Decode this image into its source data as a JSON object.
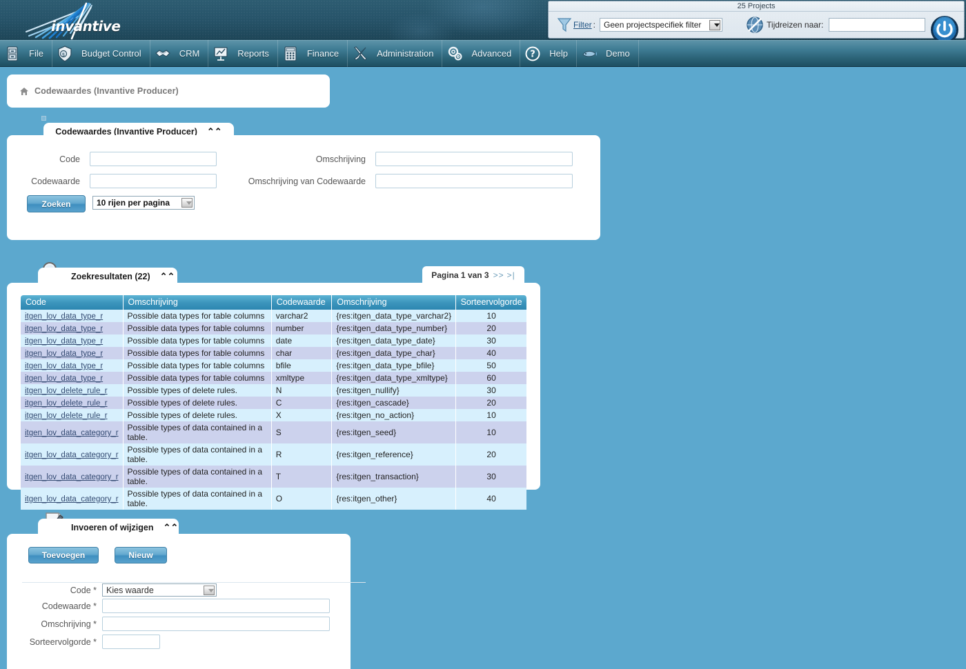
{
  "brand": {
    "name": "invantive"
  },
  "topbar": {
    "projects_title": "25 Projects",
    "filter_label": "Filter",
    "filter_colon": ":",
    "filter_value": "Geen projectspecifiek filter",
    "timetravel_label": "Tijdreizen naar:",
    "timetravel_value": "",
    "power_icon": "power-icon",
    "funnel_icon": "funnel-icon",
    "globe_icon": "globe-no-icon"
  },
  "menu": {
    "items": [
      {
        "label": "File",
        "icon": "cabinet-icon"
      },
      {
        "label": "Budget Control",
        "icon": "shield-coin-icon"
      },
      {
        "label": "CRM",
        "icon": "handshake-icon"
      },
      {
        "label": "Reports",
        "icon": "presentation-chart-icon"
      },
      {
        "label": "Finance",
        "icon": "calculator-icon"
      },
      {
        "label": "Administration",
        "icon": "tools-icon"
      },
      {
        "label": "Advanced",
        "icon": "gears-icon"
      },
      {
        "label": "Help",
        "icon": "question-circle-icon"
      },
      {
        "label": "Demo",
        "icon": "fish-icon"
      }
    ]
  },
  "breadcrumb": {
    "icon": "home-icon",
    "text": "Codewaardes (Invantive Producer)"
  },
  "search_panel": {
    "title": "Codewaardes (Invantive Producer)",
    "collapse_icon": "chevron-up-icon",
    "labels": {
      "code": "Code",
      "codewaarde": "Codewaarde",
      "omschrijving": "Omschrijving",
      "omschrijving_codewaarde": "Omschrijving van Codewaarde"
    },
    "values": {
      "code": "",
      "codewaarde": "",
      "omschrijving": "",
      "omschrijving_codewaarde": ""
    },
    "search_button": "Zoeken",
    "rows_per_page": "10 rijen per pagina"
  },
  "results_panel": {
    "title": "Zoekresultaten (22)",
    "collapse_icon": "chevron-up-icon",
    "search_icon": "magnifier-icon",
    "pager": {
      "text": "Pagina 1 van 3",
      "next": ">>",
      "last": ">|"
    },
    "columns": [
      "Code",
      "Omschrijving",
      "Codewaarde",
      "Omschrijving",
      "Sorteervolgorde"
    ],
    "rows": [
      [
        "itgen_lov_data_type_r",
        "Possible data types for table columns",
        "varchar2",
        "{res:itgen_data_type_varchar2}",
        "10"
      ],
      [
        "itgen_lov_data_type_r",
        "Possible data types for table columns",
        "number",
        "{res:itgen_data_type_number}",
        "20"
      ],
      [
        "itgen_lov_data_type_r",
        "Possible data types for table columns",
        "date",
        "{res:itgen_data_type_date}",
        "30"
      ],
      [
        "itgen_lov_data_type_r",
        "Possible data types for table columns",
        "char",
        "{res:itgen_data_type_char}",
        "40"
      ],
      [
        "itgen_lov_data_type_r",
        "Possible data types for table columns",
        "bfile",
        "{res:itgen_data_type_bfile}",
        "50"
      ],
      [
        "itgen_lov_data_type_r",
        "Possible data types for table columns",
        "xmltype",
        "{res:itgen_data_type_xmltype}",
        "60"
      ],
      [
        "itgen_lov_delete_rule_r",
        "Possible types of delete rules.",
        "N",
        "{res:itgen_nullify}",
        "30"
      ],
      [
        "itgen_lov_delete_rule_r",
        "Possible types of delete rules.",
        "C",
        "{res:itgen_cascade}",
        "20"
      ],
      [
        "itgen_lov_delete_rule_r",
        "Possible types of delete rules.",
        "X",
        "{res:itgen_no_action}",
        "10"
      ],
      [
        "itgen_lov_data_category_r",
        "Possible types of data contained in a table.",
        "S",
        "{res:itgen_seed}",
        "10"
      ],
      [
        "itgen_lov_data_category_r",
        "Possible types of data contained in a table.",
        "R",
        "{res:itgen_reference}",
        "20"
      ],
      [
        "itgen_lov_data_category_r",
        "Possible types of data contained in a table.",
        "T",
        "{res:itgen_transaction}",
        "30"
      ],
      [
        "itgen_lov_data_category_r",
        "Possible types of data contained in a table.",
        "O",
        "{res:itgen_other}",
        "40"
      ]
    ]
  },
  "edit_panel": {
    "title": "Invoeren of wijzigen",
    "collapse_icon": "chevron-up-icon",
    "note_icon": "note-pencil-icon",
    "add_button": "Toevoegen",
    "new_button": "Nieuw",
    "labels": {
      "code": "Code *",
      "codewaarde": "Codewaarde *",
      "omschrijving": "Omschrijving *",
      "sorteervolgorde": "Sorteervolgorde *"
    },
    "values": {
      "code": "Kies waarde",
      "codewaarde": "",
      "omschrijving": "",
      "sorteervolgorde": ""
    }
  },
  "colors": {
    "page_background": "#5ca8ce",
    "banner_dark": "#1d4557",
    "menu_blue": "#3e7b93",
    "table_header": "#3d96bd",
    "row_odd": "#d7f0fd",
    "row_even": "#ccd2ed",
    "link": "#334a72",
    "accent_button": "#5aa3cd"
  }
}
